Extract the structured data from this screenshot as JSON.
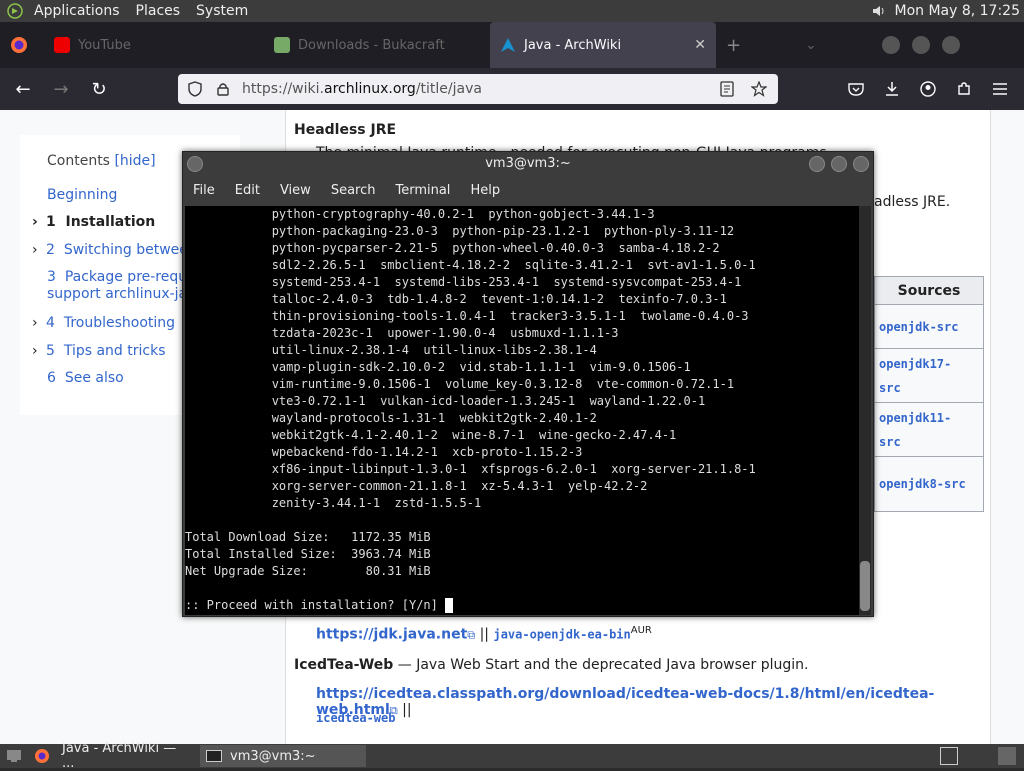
{
  "top_panel": {
    "menus": [
      "Applications",
      "Places",
      "System"
    ],
    "clock": "Mon May  8, 17:25"
  },
  "browser": {
    "tabs": [
      {
        "label": "YouTube",
        "active": false
      },
      {
        "label": "Downloads - Bukacraft",
        "active": false
      },
      {
        "label": "Java - ArchWiki",
        "active": true
      }
    ],
    "url_prefix": "https://wiki.",
    "url_host": "archlinux.org",
    "url_path": "/title/java"
  },
  "toc": {
    "title": "Contents",
    "hide": "[hide]",
    "items": [
      {
        "num": "",
        "label": "Beginning",
        "caret": false
      },
      {
        "num": "1",
        "label": "Installation",
        "caret": true,
        "current": true
      },
      {
        "num": "2",
        "label": "Switching between",
        "caret": true
      },
      {
        "num": "3",
        "label": "Package pre-requis",
        "label2": "support archlinux-java",
        "caret": false
      },
      {
        "num": "4",
        "label": "Troubleshooting",
        "caret": true
      },
      {
        "num": "5",
        "label": "Tips and tricks",
        "caret": true
      },
      {
        "num": "6",
        "label": "See also",
        "caret": false
      }
    ]
  },
  "article": {
    "heading": "Headless JRE",
    "p1": "The minimal Java runtime - needed for executing non-GUI Java programs.",
    "p2": "adless JRE.",
    "sources_header": "Sources",
    "sources": [
      "openjdk-src",
      "openjdk17-\nsrc",
      "openjdk11-\nsrc",
      "openjdk8-src"
    ],
    "row1_link": "https://jdk.java.net",
    "row1_sep": " || ",
    "row1_code": "java-openjdk-ea-bin",
    "row1_sup": "AUR",
    "icedtea_title": "IcedTea-Web",
    "icedtea_desc": " — Java Web Start and the deprecated Java browser plugin.",
    "icedtea_link": "https://icedtea.classpath.org/download/icedtea-web-docs/1.8/html/en/icedtea-web.html",
    "icedtea_sep": " ||",
    "icedtea_code": "icedtea-web"
  },
  "terminal": {
    "title": "vm3@vm3:~",
    "menus": [
      "File",
      "Edit",
      "View",
      "Search",
      "Terminal",
      "Help"
    ],
    "lines": [
      "            python-cryptography-40.0.2-1  python-gobject-3.44.1-3",
      "            python-packaging-23.0-3  python-pip-23.1.2-1  python-ply-3.11-12",
      "            python-pycparser-2.21-5  python-wheel-0.40.0-3  samba-4.18.2-2",
      "            sdl2-2.26.5-1  smbclient-4.18.2-2  sqlite-3.41.2-1  svt-av1-1.5.0-1",
      "            systemd-253.4-1  systemd-libs-253.4-1  systemd-sysvcompat-253.4-1",
      "            talloc-2.4.0-3  tdb-1.4.8-2  tevent-1:0.14.1-2  texinfo-7.0.3-1",
      "            thin-provisioning-tools-1.0.4-1  tracker3-3.5.1-1  twolame-0.4.0-3",
      "            tzdata-2023c-1  upower-1.90.0-4  usbmuxd-1.1.1-3",
      "            util-linux-2.38.1-4  util-linux-libs-2.38.1-4",
      "            vamp-plugin-sdk-2.10.0-2  vid.stab-1.1.1-1  vim-9.0.1506-1",
      "            vim-runtime-9.0.1506-1  volume_key-0.3.12-8  vte-common-0.72.1-1",
      "            vte3-0.72.1-1  vulkan-icd-loader-1.3.245-1  wayland-1.22.0-1",
      "            wayland-protocols-1.31-1  webkit2gtk-2.40.1-2",
      "            webkit2gtk-4.1-2.40.1-2  wine-8.7-1  wine-gecko-2.47.4-1",
      "            wpebackend-fdo-1.14.2-1  xcb-proto-1.15.2-3",
      "            xf86-input-libinput-1.3.0-1  xfsprogs-6.2.0-1  xorg-server-21.1.8-1",
      "            xorg-server-common-21.1.8-1  xz-5.4.3-1  yelp-42.2-2",
      "            zenity-3.44.1-1  zstd-1.5.5-1",
      "",
      "Total Download Size:   1172.35 MiB",
      "Total Installed Size:  3963.74 MiB",
      "Net Upgrade Size:        80.31 MiB",
      "",
      ":: Proceed with installation? [Y/n] "
    ]
  },
  "taskbar": {
    "tasks": [
      "Java - ArchWiki — ...",
      "vm3@vm3:~"
    ]
  }
}
